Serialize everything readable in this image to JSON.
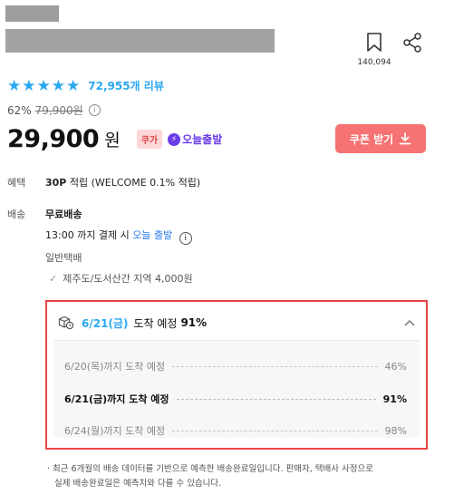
{
  "wishlist": {
    "count": "140,094"
  },
  "rating": {
    "review_count": "72,955개 리뷰"
  },
  "pricing": {
    "discount_rate": "62%",
    "original_price": "79,900원",
    "price": "29,900",
    "currency": "원",
    "badge": "쿠가",
    "today_delivery": "오늘출발"
  },
  "coupon": {
    "label": "쿠폰 받기"
  },
  "benefit": {
    "label": "혜택",
    "points": "30P",
    "points_text": "적립 (WELCOME 0.1% 적립)"
  },
  "shipping": {
    "label": "배송",
    "type": "무료배송",
    "cutoff_prefix": "13:00 까지 결제 시",
    "cutoff_highlight": "오늘 출발",
    "carrier": "일반택배",
    "remote_note": "제주도/도서산간 지역 4,000원"
  },
  "estimate": {
    "header_date": "6/21(금)",
    "header_text": "도착 예정",
    "header_rate": "91%",
    "rows": [
      {
        "label": "6/20(목)까지 도착 예정",
        "rate": "46%"
      },
      {
        "label": "6/21(금)까지 도착 예정",
        "rate": "91%"
      },
      {
        "label": "6/24(월)까지 도착 예정",
        "rate": "98%"
      }
    ]
  },
  "footnote": {
    "line1": "최근 6개월의 배송 데이터를 기반으로 예측한 배송완료일입니다. 판매자, 택배사 사정으로",
    "line2": "실제 배송완료일은 예측치와 다를 수 있습니다."
  },
  "colors": {
    "accent_blue": "#2aa8f0",
    "coupon_red": "#f77272",
    "today_purple": "#6b3de8",
    "highlight_border": "#e64545"
  }
}
